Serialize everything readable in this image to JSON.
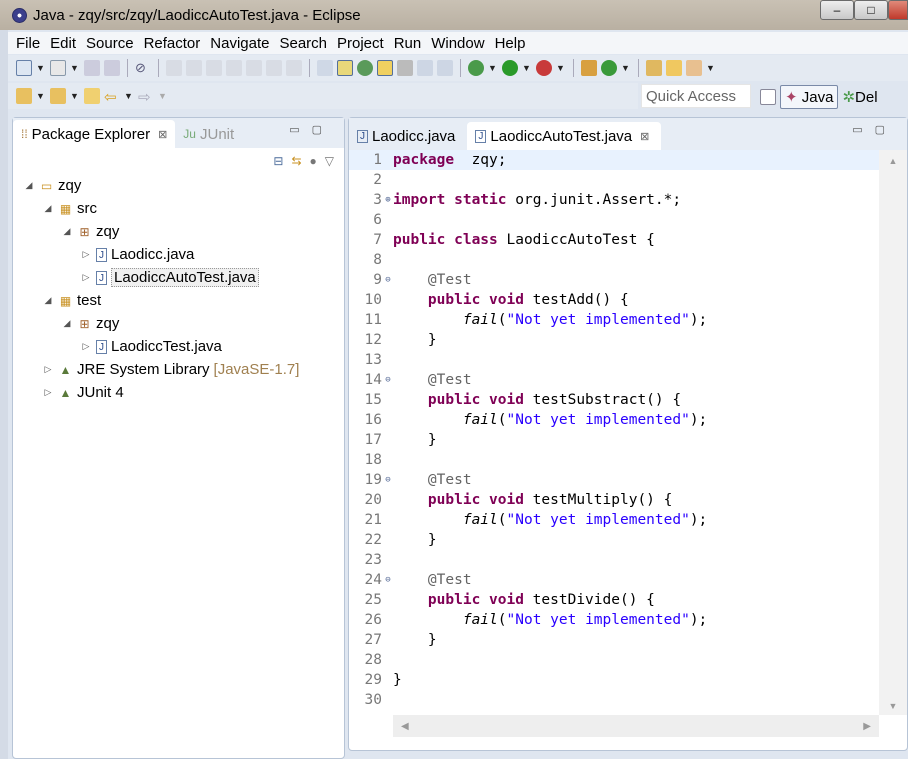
{
  "window": {
    "title": "Java - zqy/src/zqy/LaodiccAutoTest.java - Eclipse",
    "min": "–",
    "max": "□",
    "close": "x"
  },
  "menu": [
    "File",
    "Edit",
    "Source",
    "Refactor",
    "Navigate",
    "Search",
    "Project",
    "Run",
    "Window",
    "Help"
  ],
  "toolbar": {
    "quick_access": "Quick Access",
    "perspectives": [
      "Java",
      "Debug"
    ],
    "perspective_debug_visible": "Del"
  },
  "left_panel": {
    "tabs": [
      "Package Explorer",
      "JUnit"
    ],
    "tree": [
      {
        "label": "zqy",
        "level": 0,
        "icon": "project-icon",
        "expanded": true
      },
      {
        "label": "src",
        "level": 1,
        "icon": "source-folder-icon",
        "expanded": true
      },
      {
        "label": "zqy",
        "level": 2,
        "icon": "package-icon",
        "expanded": true
      },
      {
        "label": "Laodicc.java",
        "level": 3,
        "icon": "java-file-icon",
        "expanded": false
      },
      {
        "label": "LaodiccAutoTest.java",
        "level": 3,
        "icon": "java-file-icon",
        "expanded": false,
        "selected": true
      },
      {
        "label": "test",
        "level": 1,
        "icon": "source-folder-icon",
        "expanded": true
      },
      {
        "label": "zqy",
        "level": 2,
        "icon": "package-icon",
        "expanded": true
      },
      {
        "label": "LaodiccTest.java",
        "level": 3,
        "icon": "java-file-icon",
        "expanded": false
      },
      {
        "label": "JRE System Library",
        "decoration": "[JavaSE-1.7]",
        "level": 1,
        "icon": "library-icon",
        "expanded": false
      },
      {
        "label": "JUnit 4",
        "level": 1,
        "icon": "library-icon",
        "expanded": false
      }
    ]
  },
  "editor": {
    "tabs": [
      {
        "label": "Laodicc.java",
        "active": false
      },
      {
        "label": "LaodiccAutoTest.java",
        "active": true
      }
    ],
    "lines": [
      {
        "n": "1",
        "tokens": [
          [
            "kw",
            "package"
          ],
          [
            "",
            "  zqy;"
          ]
        ]
      },
      {
        "n": "2",
        "tokens": []
      },
      {
        "n": "3",
        "fold": "+",
        "tokens": [
          [
            "kw",
            "import static"
          ],
          [
            "",
            " org.junit.Assert.*;"
          ]
        ]
      },
      {
        "n": "6",
        "tokens": []
      },
      {
        "n": "7",
        "tokens": [
          [
            "kw",
            "public class"
          ],
          [
            "",
            " LaodiccAutoTest {"
          ]
        ]
      },
      {
        "n": "8",
        "tokens": []
      },
      {
        "n": "9",
        "fold": "-",
        "tokens": [
          [
            "",
            "    "
          ],
          [
            "ann",
            "@Test"
          ]
        ]
      },
      {
        "n": "10",
        "tokens": [
          [
            "",
            "    "
          ],
          [
            "kw",
            "public void"
          ],
          [
            "",
            " testAdd() {"
          ]
        ]
      },
      {
        "n": "11",
        "tokens": [
          [
            "",
            "        "
          ],
          [
            "it",
            "fail"
          ],
          [
            "",
            "("
          ],
          [
            "str",
            "\"Not yet implemented\""
          ],
          [
            "",
            ");"
          ]
        ]
      },
      {
        "n": "12",
        "tokens": [
          [
            "",
            "    }"
          ]
        ]
      },
      {
        "n": "13",
        "tokens": []
      },
      {
        "n": "14",
        "fold": "-",
        "tokens": [
          [
            "",
            "    "
          ],
          [
            "ann",
            "@Test"
          ]
        ]
      },
      {
        "n": "15",
        "tokens": [
          [
            "",
            "    "
          ],
          [
            "kw",
            "public void"
          ],
          [
            "",
            " testSubstract() {"
          ]
        ]
      },
      {
        "n": "16",
        "tokens": [
          [
            "",
            "        "
          ],
          [
            "it",
            "fail"
          ],
          [
            "",
            "("
          ],
          [
            "str",
            "\"Not yet implemented\""
          ],
          [
            "",
            ");"
          ]
        ]
      },
      {
        "n": "17",
        "tokens": [
          [
            "",
            "    }"
          ]
        ]
      },
      {
        "n": "18",
        "tokens": []
      },
      {
        "n": "19",
        "fold": "-",
        "tokens": [
          [
            "",
            "    "
          ],
          [
            "ann",
            "@Test"
          ]
        ]
      },
      {
        "n": "20",
        "tokens": [
          [
            "",
            "    "
          ],
          [
            "kw",
            "public void"
          ],
          [
            "",
            " testMultiply() {"
          ]
        ]
      },
      {
        "n": "21",
        "tokens": [
          [
            "",
            "        "
          ],
          [
            "it",
            "fail"
          ],
          [
            "",
            "("
          ],
          [
            "str",
            "\"Not yet implemented\""
          ],
          [
            "",
            ");"
          ]
        ]
      },
      {
        "n": "22",
        "tokens": [
          [
            "",
            "    }"
          ]
        ]
      },
      {
        "n": "23",
        "tokens": []
      },
      {
        "n": "24",
        "fold": "-",
        "tokens": [
          [
            "",
            "    "
          ],
          [
            "ann",
            "@Test"
          ]
        ]
      },
      {
        "n": "25",
        "tokens": [
          [
            "",
            "    "
          ],
          [
            "kw",
            "public void"
          ],
          [
            "",
            " testDivide() {"
          ]
        ]
      },
      {
        "n": "26",
        "tokens": [
          [
            "",
            "        "
          ],
          [
            "it",
            "fail"
          ],
          [
            "",
            "("
          ],
          [
            "str",
            "\"Not yet implemented\""
          ],
          [
            "",
            ");"
          ]
        ]
      },
      {
        "n": "27",
        "tokens": [
          [
            "",
            "    }"
          ]
        ]
      },
      {
        "n": "28",
        "tokens": []
      },
      {
        "n": "29",
        "tokens": [
          [
            "",
            "}"
          ]
        ]
      },
      {
        "n": "30",
        "tokens": []
      }
    ]
  },
  "colors": {
    "keyword": "#7f0055",
    "string": "#2a00ff",
    "annotation": "#646464",
    "current_line": "#e8f2fe"
  }
}
